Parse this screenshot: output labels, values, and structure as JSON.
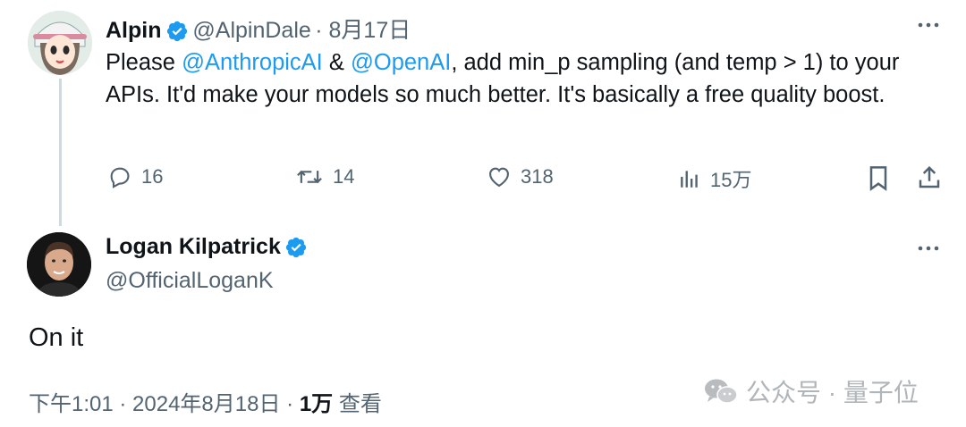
{
  "parent": {
    "name": "Alpin",
    "handle": "@AlpinDale",
    "date": "· 8月17日",
    "text_pre": "Please ",
    "mention1": "@AnthropicAI",
    "text_mid": " & ",
    "mention2": "@OpenAI",
    "text_post": ", add min_p sampling (and temp > 1) to your APIs. It'd make your models so much better. It's basically a free quality boost.",
    "replies": "16",
    "reposts": "14",
    "likes": "318",
    "views": "15万"
  },
  "reply": {
    "name": "Logan Kilpatrick",
    "handle": "@OfficialLoganK",
    "text": "On it",
    "time_date": "下午1:01 · 2024年8月18日 · ",
    "views": "1万",
    "views_label": " 查看"
  },
  "watermark": "公众号 · 量子位",
  "colors": {
    "accent": "#1d9bf0",
    "muted": "#536471",
    "text": "#0f1419",
    "line": "#cfd9de"
  }
}
